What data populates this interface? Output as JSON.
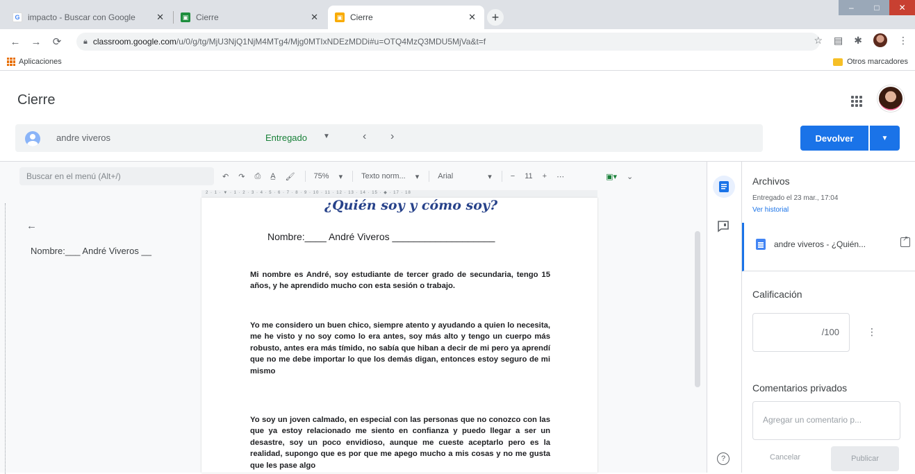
{
  "browser": {
    "tabs": [
      {
        "label": "impacto - Buscar con Google",
        "icon": "google-icon",
        "close": "✕"
      },
      {
        "label": "Cierre",
        "icon": "classroom-icon",
        "close": "✕"
      },
      {
        "label": "Cierre",
        "icon": "classroom-icon",
        "close": "✕"
      }
    ],
    "new_tab": "+",
    "url_host": "classroom.google.com",
    "url_path": "/u/0/g/tg/MjU3NjQ1NjM4MTg4/Mjg0MTIxNDEzMDDi#u=OTQ4MzQ3MDU5MjVa&t=f",
    "bookmarks": {
      "apps": "Aplicaciones",
      "other": "Otros marcadores"
    }
  },
  "classroom": {
    "title": "Cierre",
    "student_name": "andre viveros",
    "status": "Entregado",
    "return_button": "Devolver"
  },
  "docs": {
    "menu_search_placeholder": "Buscar en el menú (Alt+/)",
    "zoom": "75%",
    "style": "Texto norm...",
    "font": "Arial",
    "font_size": "11",
    "ruler": "2 · 1 · ▼ · 1 · 2 · 3 · 4 · 5 · 6 · 7 · 8 · 9 · 10 · 11 · 12 · 13 · 14 · 15 · ◆ · 17 · 18",
    "outline_item": "Nombre:___ André Viveros __",
    "document": {
      "title": "¿Quién soy y cómo soy?",
      "name_line": "Nombre:____ André Viveros ___________________",
      "paragraphs": [
        "Mi nombre es André, soy estudiante de tercer grado de secundaria, tengo 15 años, y he aprendido mucho con esta sesión o trabajo.",
        "Yo me considero un buen chico, siempre atento y ayudando a quien lo necesita, me he visto y no soy como lo era antes, soy más alto y tengo un cuerpo más robusto, antes era más tímido, no sabía que hiban a decir de mi pero ya aprendí que no me debe importar lo que los demás digan, entonces estoy seguro de mi mismo",
        "Yo soy un joven calmado, en especial con las personas que no conozco con las que ya estoy relacionado me siento en confianza y puedo llegar a ser un desastre, soy un poco envidioso, aunque me cueste aceptarlo pero es la realidad, supongo que es por que me apego mucho a mis cosas y no me gusta que les pase algo"
      ]
    }
  },
  "side_panel": {
    "files_heading": "Archivos",
    "submitted_on": "Entregado el 23 mar., 17:04",
    "view_history": "Ver historial",
    "file_name": "andre viveros - ¿Quién...",
    "grade_heading": "Calificación",
    "grade_max": "/100",
    "comments_heading": "Comentarios privados",
    "comment_placeholder": "Agregar un comentario p...",
    "cancel": "Cancelar",
    "publish": "Publicar"
  }
}
